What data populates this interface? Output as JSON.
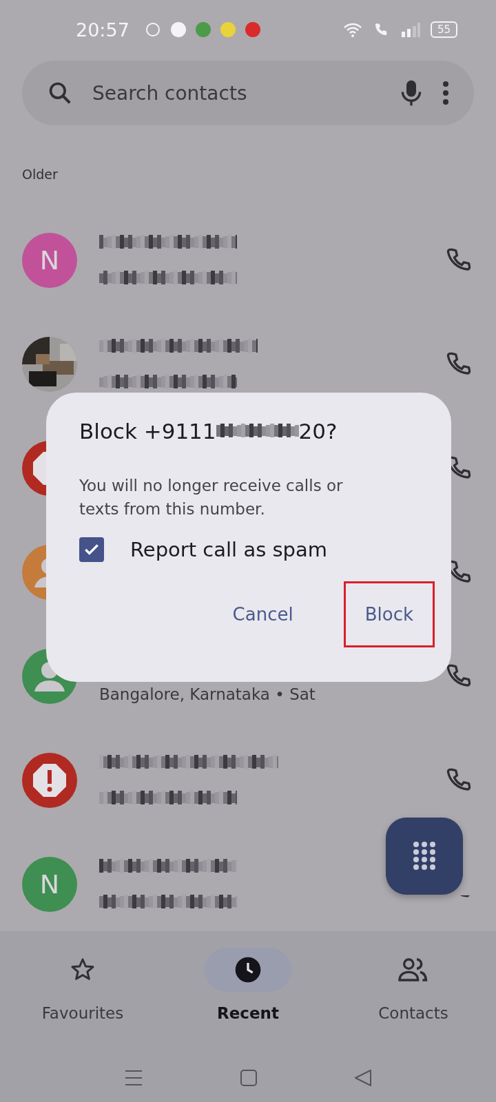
{
  "status_bar": {
    "time": "20:57",
    "battery": "55"
  },
  "search": {
    "placeholder": "Search contacts"
  },
  "section_label": "Older",
  "calls": [
    {
      "avatar": {
        "kind": "letter",
        "letter": "N",
        "color": "#c1529a"
      },
      "name_pixelated": true,
      "detail_pixelated": true
    },
    {
      "name_pixelated": true,
      "detail_pixelated": true
    },
    {
      "avatar": {
        "kind": "spam",
        "color": "#b12a22"
      },
      "name_pixelated": false,
      "detail_pixelated": false
    },
    {
      "avatar": {
        "kind": "person",
        "color": "#c47b3c"
      },
      "name_pixelated": false,
      "detail_pixelated": false
    },
    {
      "avatar": {
        "kind": "person",
        "color": "#3f8e52"
      },
      "name_pixelated": false,
      "detail": "Bangalore, Karnataka • Sat"
    },
    {
      "avatar": {
        "kind": "spam",
        "color": "#b12a22"
      },
      "name_pixelated": true,
      "detail_pixelated": true
    },
    {
      "avatar": {
        "kind": "letter",
        "letter": "N",
        "color": "#3f8e52"
      },
      "name_pixelated": true,
      "detail_pixelated": true
    }
  ],
  "dialog": {
    "title_start": "Block +9111",
    "title_end": "20?",
    "message": "You will no longer receive calls or texts from this number.",
    "checkbox": {
      "label": "Report call as spam",
      "checked": true
    },
    "buttons": [
      {
        "label": "Cancel",
        "highlighted": false
      },
      {
        "label": "Block",
        "highlighted": true
      }
    ]
  },
  "nav": [
    {
      "label": "Favourites",
      "selected": false
    },
    {
      "label": "Recent",
      "selected": true
    },
    {
      "label": "Contacts",
      "selected": false
    }
  ]
}
